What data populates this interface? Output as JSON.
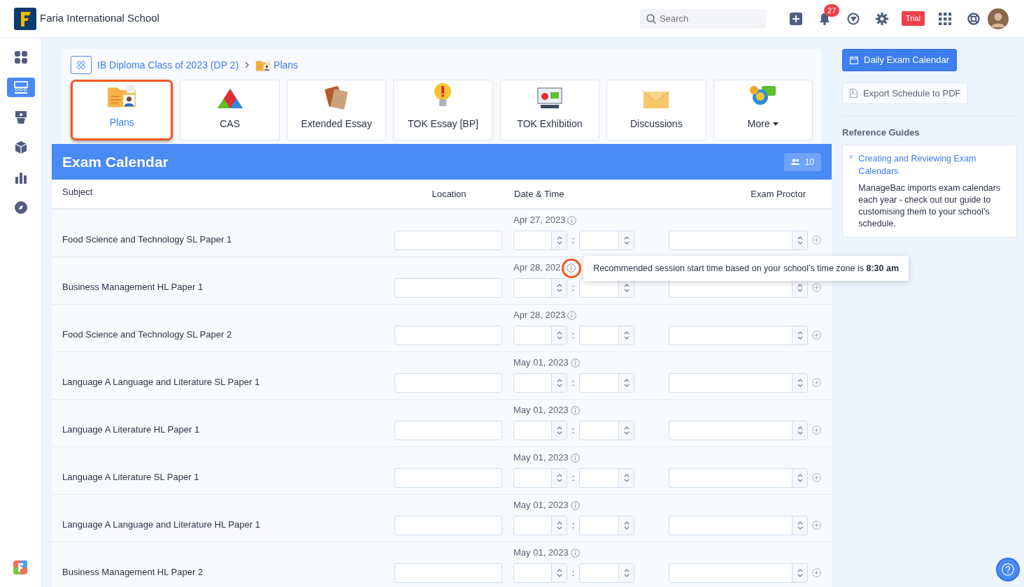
{
  "header": {
    "school_name": "Faria International School",
    "search": {
      "placeholder": "Search"
    },
    "notification_count": "27",
    "trial_badge": "Trial"
  },
  "sidebar": {
    "items": [
      {
        "selected": false
      },
      {
        "selected": true
      },
      {
        "selected": false
      },
      {
        "selected": false
      },
      {
        "selected": false
      },
      {
        "selected": false
      }
    ]
  },
  "breadcrumb": [
    "IB Diploma Class of 2023 (DP 2)",
    "Plans"
  ],
  "tabs": [
    {
      "label": "Plans",
      "kind": "tab",
      "selected": true,
      "highlighted": true
    },
    {
      "label": "CAS",
      "kind": "tab",
      "selected": false,
      "highlighted": false
    },
    {
      "label": "Extended Essay",
      "kind": "tab",
      "selected": false,
      "highlighted": false
    },
    {
      "label": "TOK Essay [BP]",
      "kind": "tab",
      "selected": false,
      "highlighted": false
    },
    {
      "label": "TOK Exhibition",
      "kind": "tab",
      "selected": false,
      "highlighted": false
    },
    {
      "label": "Discussions",
      "kind": "tab",
      "selected": false,
      "highlighted": false
    },
    {
      "label": "More",
      "kind": "dropdown",
      "selected": false,
      "highlighted": false
    }
  ],
  "exam_calendar": {
    "title": "Exam Calendar",
    "member_count": "10",
    "columns": [
      "Subject",
      "Location",
      "Date & Time",
      "Exam Proctor"
    ],
    "rows": [
      {
        "subject": "Food Science and Technology SL Paper 1",
        "date": "Apr 27, 2023",
        "info_highlighted": false,
        "separator": ":"
      },
      {
        "subject": "Business Management HL Paper 1",
        "date": "Apr 28, 202",
        "info_highlighted": true,
        "separator": ":",
        "tooltip": "Recommended session start time based on your school’s time zone is **8:30 am**"
      },
      {
        "subject": "Food Science and Technology SL Paper 2",
        "date": "Apr 28, 2023",
        "info_highlighted": false,
        "separator": ":"
      },
      {
        "subject": "Language A Language and Literature SL Paper 1",
        "date": "May 01, 2023",
        "info_highlighted": false,
        "separator": ":"
      },
      {
        "subject": "Language A Literature HL Paper 1",
        "date": "May 01, 2023",
        "info_highlighted": false,
        "separator": ":"
      },
      {
        "subject": "Language A Literature SL Paper 1",
        "date": "May 01, 2023",
        "info_highlighted": false,
        "separator": ":"
      },
      {
        "subject": "Language A Language and Literature HL Paper 1",
        "date": "May 01, 2023",
        "info_highlighted": false,
        "separator": ":"
      },
      {
        "subject": "Business Management HL Paper 2",
        "date": "May 01, 2023",
        "info_highlighted": false,
        "separator": ":"
      }
    ]
  },
  "actions": [
    {
      "label": "Daily Exam Calendar",
      "kind": "primary"
    },
    {
      "label": "Export Schedule to PDF",
      "kind": "secondary"
    }
  ],
  "reference_guides": {
    "title": "Reference Guides",
    "items": [
      {
        "link": "Creating and Reviewing Exam Calendars",
        "description": "ManageBac imports exam calendars each year - check out our guide to customising them to your school’s schedule."
      }
    ]
  }
}
